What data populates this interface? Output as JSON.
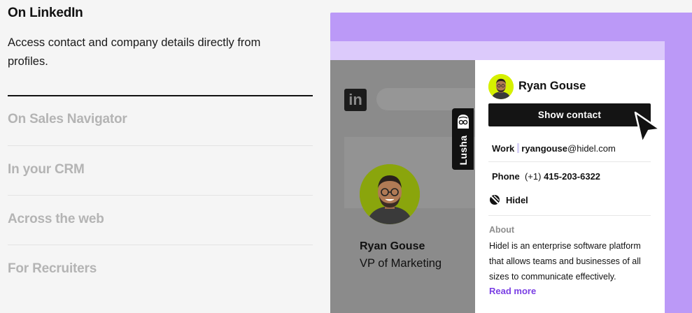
{
  "left": {
    "active": {
      "title": "On LinkedIn",
      "description": "Access contact and company details directly from profiles."
    },
    "items": [
      {
        "label": "On Sales Navigator"
      },
      {
        "label": "In your CRM"
      },
      {
        "label": "Across the web"
      },
      {
        "label": "For Recruiters"
      }
    ]
  },
  "profile": {
    "name": "Ryan Gouse",
    "role": "VP of Marketing",
    "logo_text": "in"
  },
  "lusha_tab": {
    "label": "Lusha"
  },
  "panel": {
    "name": "Ryan Gouse",
    "show_contact": "Show contact",
    "work_label": "Work",
    "work_user": "ryangouse",
    "work_domain": "@hidel.com",
    "phone_label": "Phone",
    "phone_code": "(+1)",
    "phone_number": "415-203-6322",
    "company": "Hidel",
    "about_heading": "About",
    "about_text": "Hidel is an enterprise software platform that allows teams and businesses of all sizes to communicate effectively.",
    "read_more": "Read more"
  },
  "colors": {
    "purple": "#bb99f7",
    "lavender": "#dccafb",
    "overlay_gray": "#8b8b8b",
    "accent_lime": "#d6f000",
    "link_purple": "#7a3fe4"
  },
  "icons": [
    "linkedin-logo-icon",
    "lusha-logo-icon",
    "cursor-arrow-icon",
    "company-logo-icon"
  ]
}
